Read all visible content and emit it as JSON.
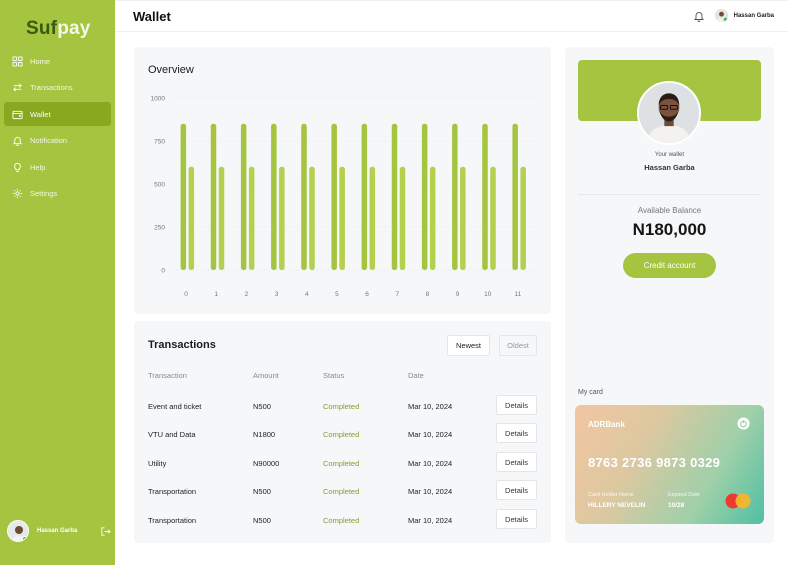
{
  "brand": {
    "part1": "Suf",
    "part2": "pay"
  },
  "sidebar": {
    "items": [
      {
        "label": "Home",
        "icon": "grid-icon"
      },
      {
        "label": "Transactions",
        "icon": "swap-arrows-icon"
      },
      {
        "label": "Wallet",
        "icon": "wallet-icon",
        "active": true
      },
      {
        "label": "Notification",
        "icon": "bell-icon"
      },
      {
        "label": "Help",
        "icon": "help-bulb-icon"
      },
      {
        "label": "Settings",
        "icon": "gear-icon"
      }
    ],
    "user_name": "Hassan Garba"
  },
  "header": {
    "title": "Wallet",
    "user_name": "Hassan Garba"
  },
  "overview": {
    "title": "Overview"
  },
  "chart_data": {
    "type": "bar",
    "categories": [
      "0",
      "1",
      "2",
      "3",
      "4",
      "5",
      "6",
      "7",
      "8",
      "9",
      "10",
      "11"
    ],
    "series": [
      {
        "values": [
          850,
          850,
          850,
          850,
          850,
          850,
          850,
          850,
          850,
          850,
          850,
          850
        ]
      },
      {
        "values": [
          600,
          600,
          600,
          600,
          600,
          600,
          600,
          600,
          600,
          600,
          600,
          600
        ]
      }
    ],
    "yticks": [
      "0",
      "250",
      "500",
      "750",
      "1000"
    ],
    "ylim": [
      0,
      1000
    ],
    "grid": true,
    "colors": [
      "#a5c43f",
      "#b3d04e"
    ]
  },
  "transactions": {
    "title": "Transactions",
    "sort": {
      "newest": "Newest",
      "oldest": "Oldest"
    },
    "columns": [
      "Transaction",
      "Amount",
      "Status",
      "Date"
    ],
    "rows": [
      {
        "name": "Event and ticket",
        "amount": "N500",
        "status": "Completed",
        "date": "Mar 10, 2024",
        "action": "Details"
      },
      {
        "name": "VTU and Data",
        "amount": "N1800",
        "status": "Completed",
        "date": "Mar 10, 2024",
        "action": "Details"
      },
      {
        "name": "Utility",
        "amount": "N90000",
        "status": "Completed",
        "date": "Mar 10, 2024",
        "action": "Details"
      },
      {
        "name": "Transportation",
        "amount": "N500",
        "status": "Completed",
        "date": "Mar 10, 2024",
        "action": "Details"
      },
      {
        "name": "Transportation",
        "amount": "N500",
        "status": "Completed",
        "date": "Mar 10, 2024",
        "action": "Details"
      }
    ]
  },
  "wallet": {
    "label": "Your wallet",
    "name": "Hassan Garba",
    "balance_label": "Available Balance",
    "balance": "N180,000",
    "credit_button": "Credit account",
    "my_card_label": "My card"
  },
  "card": {
    "bank": "ADRBank",
    "number": "8763 2736 9873 0329",
    "holder_label": "Card Holder Name",
    "holder": "HILLERY NEVELIN",
    "expiry_label": "Expired Date",
    "expiry": "10/28"
  },
  "colors": {
    "accent": "#a5c43f",
    "accent_dark": "#88a81f",
    "status_green": "#7ea12a"
  }
}
